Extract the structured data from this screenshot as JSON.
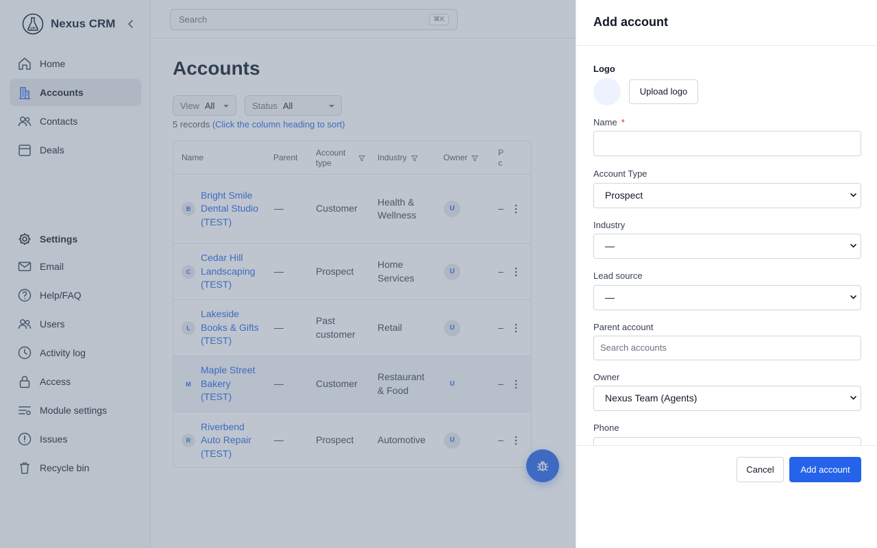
{
  "app": {
    "name": "Nexus CRM"
  },
  "sidebar": {
    "items": [
      {
        "label": "Home",
        "icon": "home-icon"
      },
      {
        "label": "Accounts",
        "icon": "building-icon",
        "active": true
      },
      {
        "label": "Contacts",
        "icon": "people-icon"
      },
      {
        "label": "Deals",
        "icon": "calendar-icon"
      }
    ],
    "settings_label": "Settings",
    "settings_items": [
      {
        "label": "Email",
        "icon": "mail-icon"
      },
      {
        "label": "Help/FAQ",
        "icon": "help-icon"
      },
      {
        "label": "Users",
        "icon": "users-icon"
      },
      {
        "label": "Activity log",
        "icon": "clock-icon"
      },
      {
        "label": "Access",
        "icon": "lock-icon"
      },
      {
        "label": "Module settings",
        "icon": "sliders-icon"
      },
      {
        "label": "Issues",
        "icon": "alert-icon"
      },
      {
        "label": "Recycle bin",
        "icon": "trash-icon"
      }
    ]
  },
  "search": {
    "placeholder": "Search",
    "shortcut": "⌘K"
  },
  "page": {
    "title": "Accounts",
    "filters": [
      {
        "label": "View",
        "value": "All"
      },
      {
        "label": "Status",
        "value": "All"
      }
    ],
    "records_count": "5 records",
    "records_hint": "(Click the column heading to sort)"
  },
  "table": {
    "columns": [
      "Name",
      "Parent",
      "Account type",
      "Industry",
      "Owner",
      "P c"
    ],
    "rows": [
      {
        "initial": "B",
        "name": "Bright Smile Dental Studio (TEST)",
        "parent": "—",
        "type": "Customer",
        "industry": "Health & Wellness",
        "owner": "U",
        "extra": "–"
      },
      {
        "initial": "C",
        "name": "Cedar Hill Landscaping (TEST)",
        "parent": "—",
        "type": "Prospect",
        "industry": "Home Services",
        "owner": "U",
        "extra": "–"
      },
      {
        "initial": "L",
        "name": "Lakeside Books & Gifts (TEST)",
        "parent": "—",
        "type": "Past customer",
        "industry": "Retail",
        "owner": "U",
        "extra": "–"
      },
      {
        "initial": "M",
        "name": "Maple Street Bakery (TEST)",
        "parent": "—",
        "type": "Customer",
        "industry": "Restaurant & Food",
        "owner": "U",
        "extra": "–"
      },
      {
        "initial": "R",
        "name": "Riverbend Auto Repair (TEST)",
        "parent": "—",
        "type": "Prospect",
        "industry": "Automotive",
        "owner": "U",
        "extra": "–"
      }
    ]
  },
  "drawer": {
    "title": "Add account",
    "logo_label": "Logo",
    "upload_label": "Upload logo",
    "name_label": "Name",
    "required_mark": "*",
    "name_value": "",
    "account_type_label": "Account Type",
    "account_type_value": "Prospect",
    "industry_label": "Industry",
    "industry_value": "—",
    "lead_source_label": "Lead source",
    "lead_source_value": "—",
    "parent_label": "Parent account",
    "parent_placeholder": "Search accounts",
    "owner_label": "Owner",
    "owner_value": "Nexus Team (Agents)",
    "phone_label": "Phone",
    "cancel_label": "Cancel",
    "submit_label": "Add account"
  },
  "colors": {
    "accent": "#2563eb",
    "required": "#dc2626"
  }
}
